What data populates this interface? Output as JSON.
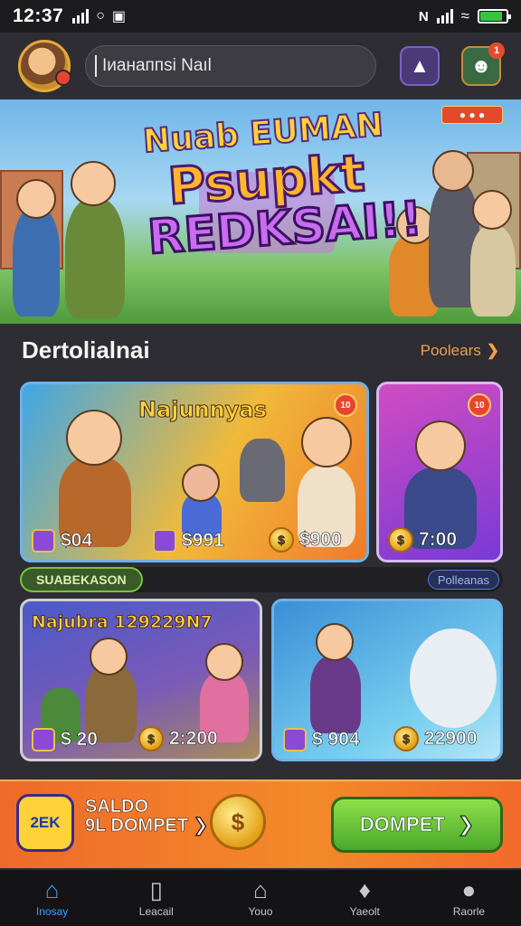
{
  "status_bar": {
    "time": "12:37",
    "battery_level": 0.85,
    "icons": [
      "signal-icon",
      "vpn-icon",
      "image-icon",
      "nfc-icon",
      "signal-icon",
      "wifi-icon",
      "battery-icon"
    ]
  },
  "header": {
    "search_text": "Iианаппsi Naıl",
    "notification_count": "1"
  },
  "banner": {
    "line1": "Nuab EUMAN",
    "line2": "Psupkt",
    "line3": "REDKSAI!!",
    "tag": "● ● ●"
  },
  "section": {
    "title": "Dertolialnai",
    "link": "Poolears"
  },
  "cards": [
    {
      "name": "Najunnyas",
      "price1": "$04",
      "price2": "$991",
      "price3": "$900",
      "badge": "10"
    },
    {
      "name": "",
      "price1": "7:00",
      "badge": "10"
    },
    {
      "name": "Najubra  129229N7",
      "price1": "$ 20",
      "price2": "2:200"
    },
    {
      "name": "",
      "price1": "$ 904",
      "price2": "22900"
    }
  ],
  "subbar": {
    "pill": "SUABEKASON",
    "link": "Polleanas"
  },
  "wallet": {
    "label_line1": "SALDO",
    "label_line2": "9L DOMPET",
    "logo_text": "2EK",
    "button_label": "DOMPET"
  },
  "bottom_nav": [
    {
      "label": "Inosay",
      "icon": "home-icon",
      "active": true
    },
    {
      "label": "Leacail",
      "icon": "wallet-icon",
      "active": false
    },
    {
      "label": "Youo",
      "icon": "house-icon",
      "active": false
    },
    {
      "label": "Yaeolt",
      "icon": "tag-icon",
      "active": false
    },
    {
      "label": "Raorle",
      "icon": "gamepad-icon",
      "active": false
    }
  ],
  "colors": {
    "accent": "#3aa2ff",
    "wallet_bg": "#f06a2a",
    "wallet_button": "#4aa82a",
    "link": "#f0a04a"
  }
}
